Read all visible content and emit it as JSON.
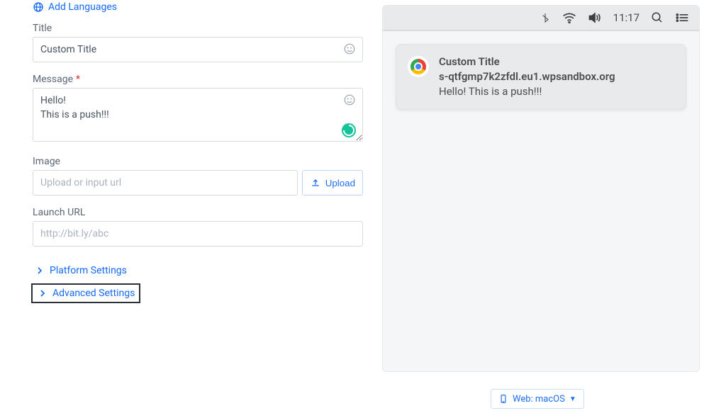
{
  "header": {
    "add_languages": "Add Languages"
  },
  "fields": {
    "title": {
      "label": "Title",
      "value": "Custom Title"
    },
    "message": {
      "label": "Message",
      "value": "Hello!\nThis is a push!!!"
    },
    "image": {
      "label": "Image",
      "placeholder": "Upload or input url",
      "upload_label": "Upload"
    },
    "launch_url": {
      "label": "Launch URL",
      "placeholder": "http://bit.ly/abc"
    }
  },
  "collapsibles": {
    "platform_settings": "Platform Settings",
    "advanced_settings": "Advanced Settings"
  },
  "preview": {
    "time": "11:17",
    "notif": {
      "title": "Custom Title",
      "domain": "s-qtfgmp7k2zfdl.eu1.wpsandbox.org",
      "body": "Hello! This is a push!!!"
    }
  },
  "web_selector": {
    "label": "Web: macOS"
  }
}
